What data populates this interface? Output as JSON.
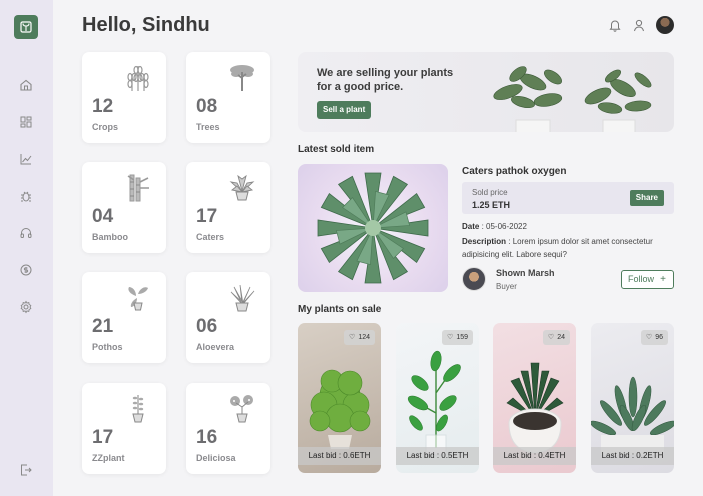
{
  "header": {
    "greeting": "Hello, Sindhu"
  },
  "sidebar": {
    "items": [
      "home-icon",
      "dashboard-icon",
      "chart-icon",
      "bug-icon",
      "headset-icon",
      "currency-icon",
      "settings-icon",
      "logout-icon"
    ]
  },
  "stats": [
    {
      "value": "12",
      "label": "Crops",
      "icon": "wheat-icon"
    },
    {
      "value": "08",
      "label": "Trees",
      "icon": "tree-icon"
    },
    {
      "value": "04",
      "label": "Bamboo",
      "icon": "bamboo-icon"
    },
    {
      "value": "17",
      "label": "Caters",
      "icon": "succulent-icon"
    },
    {
      "value": "21",
      "label": "Pothos",
      "icon": "pothos-icon"
    },
    {
      "value": "06",
      "label": "Aloevera",
      "icon": "aloe-icon"
    },
    {
      "value": "17",
      "label": "ZZplant",
      "icon": "zzplant-icon"
    },
    {
      "value": "16",
      "label": "Deliciosa",
      "icon": "monstera-icon"
    }
  ],
  "banner": {
    "text": "We are selling your plants for a good price.",
    "button": "Sell a plant"
  },
  "latest": {
    "section_title": "Latest sold item",
    "title": "Caters pathok oxygen",
    "sold_price_label": "Sold price",
    "sold_price": "1.25 ETH",
    "share": "Share",
    "date_label": "Date",
    "date": "05-06-2022",
    "description_label": "Description",
    "description": "Lorem ipsum dolor sit amet consectetur adipisicing elit. Labore sequi?",
    "buyer_name": "Shown Marsh",
    "buyer_role": "Buyer",
    "follow": "Follow"
  },
  "on_sale": {
    "section_title": "My plants on sale",
    "items": [
      {
        "likes": "124",
        "bid": "Last bid : 0.6ETH"
      },
      {
        "likes": "159",
        "bid": "Last bid : 0.5ETH"
      },
      {
        "likes": "24",
        "bid": "Last bid : 0.4ETH"
      },
      {
        "likes": "96",
        "bid": "Last bid : 0.2ETH"
      }
    ]
  },
  "colors": {
    "accent": "#4e7c5c",
    "sidebar": "#e9e6f1",
    "background": "#f4f4f6"
  }
}
